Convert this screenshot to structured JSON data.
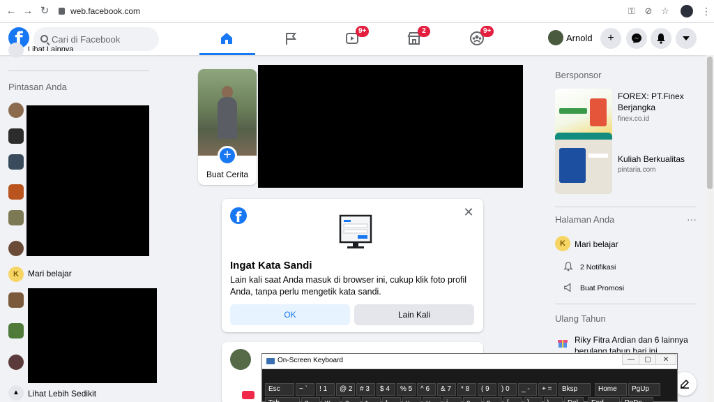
{
  "browser": {
    "url": "web.facebook.com",
    "back_icon": "arrow-left-icon",
    "forward_icon": "arrow-right-icon",
    "reload_icon": "reload-icon"
  },
  "topbar": {
    "logo": "f",
    "search_placeholder": "Cari di Facebook",
    "badges": {
      "watch": "9+",
      "marketplace": "2",
      "groups": "9+"
    },
    "profile_name": "Arnold",
    "plus_label": "+"
  },
  "left": {
    "see_more_top": "Lihat Lainnya",
    "shortcuts_heading": "Pintasan Anda",
    "page_name": "Mari belajar",
    "page_initial": "K",
    "see_less": "Lihat Lebih Sedikit"
  },
  "story": {
    "create_label": "Buat Cerita"
  },
  "dialog": {
    "logo": "f",
    "title": "Ingat Kata Sandi",
    "text": "Lain kali saat Anda masuk di browser ini, cukup klik foto profil Anda, tanpa perlu mengetik kata sandi.",
    "ok_label": "OK",
    "later_label": "Lain Kali",
    "close_label": "✕"
  },
  "right": {
    "sponsored_heading": "Bersponsor",
    "ads": [
      {
        "title": "FOREX: PT.Finex Berjangka",
        "domain": "finex.co.id"
      },
      {
        "title": "Kuliah Berkualitas",
        "domain": "pintaria.com"
      }
    ],
    "pages_heading": "Halaman Anda",
    "page_name": "Mari belajar",
    "page_initial": "K",
    "notifications": "2 Notifikasi",
    "promote": "Buat Promosi",
    "birthday_heading": "Ulang Tahun",
    "birthday_name": "Riky Fitra Ardian",
    "birthday_rest": " dan 6 lainnya",
    "birthday_line2": "berulang tahun hari ini."
  },
  "osk": {
    "title": "On-Screen Keyboard",
    "minimize": "—",
    "restore": "▢",
    "close": "✕",
    "row1": [
      "Esc",
      "~ `",
      "! 1",
      "@ 2",
      "# 3",
      "$ 4",
      "% 5",
      "^ 6",
      "& 7",
      "* 8",
      "( 9",
      ") 0",
      "_ -",
      "+ =",
      "Bksp",
      "Home",
      "PgUp"
    ],
    "row2": [
      "Tab",
      "q",
      "w",
      "e",
      "r",
      "t",
      "y",
      "u",
      "i",
      "o",
      "p",
      "[",
      "]",
      "\\",
      "Del",
      "End",
      "PgDn"
    ]
  },
  "colors": {
    "brand": "#1877f2",
    "badge": "#e41e3f",
    "page_bg": "#f0f2f5"
  }
}
